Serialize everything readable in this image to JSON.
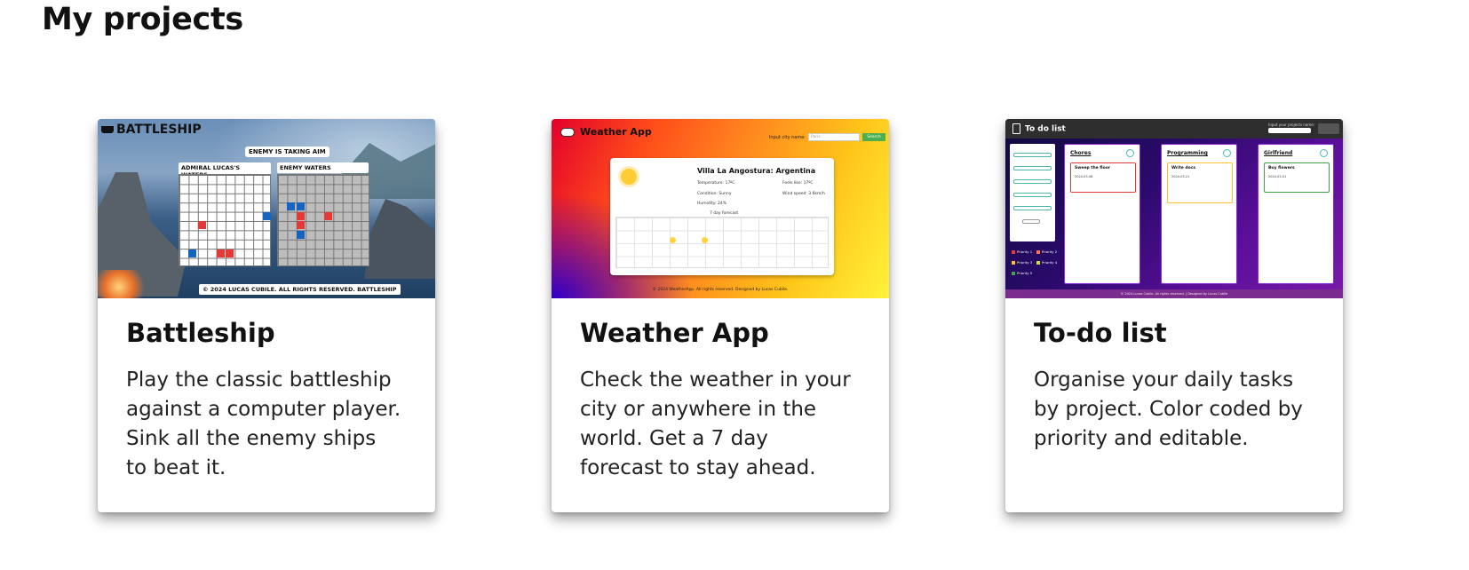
{
  "page": {
    "title": "My projects"
  },
  "projects": [
    {
      "title": "Battleship",
      "description": "Play the classic battleship against a computer player. Sink all the enemy ships to beat it.",
      "preview": {
        "logo": "BATTLESHIP",
        "banner": "ENEMY IS TAKING AIM",
        "player_grid_label": "ADMIRAL LUCAS'S WATERS",
        "enemy_grid_label": "ENEMY WATERS",
        "footer": "© 2024 LUCAS CUBILE. ALL RIGHTS RESERVED. BATTLESHIP"
      }
    },
    {
      "title": "Weather App",
      "description": "Check the weather in your city or anywhere in the world. Get a 7 day forecast to stay ahead.",
      "preview": {
        "brand": "Weather App",
        "search_label": "Input city name:",
        "search_placeholder": "Paris",
        "search_button": "Search",
        "city": "Villa La Angostura: Argentina",
        "temperature": "Temperature: 17ºC",
        "feels_like": "Feels like: 17ºC",
        "condition": "Condition: Sunny",
        "wind": "Wind speed: 3.6km/h",
        "humidity": "Humidity: 24%",
        "forecast_caption": "7 day forecast",
        "footer": "© 2024 WeatherApp. All rights reserved. Designed by Lucas Cubile."
      }
    },
    {
      "title": "To-do list",
      "description": "Organise your daily tasks by project. Color coded by priority and editable.",
      "preview": {
        "brand": "To do list",
        "project_input_label": "Input your projects name:",
        "columns": [
          {
            "name": "Chores",
            "task": "Sweep the floor",
            "date": "2024-03-08"
          },
          {
            "name": "Programming",
            "task": "Write docs",
            "date": "2024-03-21"
          },
          {
            "name": "Girlfriend",
            "task": "Buy flowers",
            "date": "2024-03-01"
          }
        ],
        "legend": [
          "Priority 1",
          "Priority 2",
          "Priority 3",
          "Priority 4",
          "Priority 5"
        ],
        "footer": "© 2024 Lucas Cubile. All rights reserved. | Designed by Lucas Cubile"
      }
    }
  ]
}
